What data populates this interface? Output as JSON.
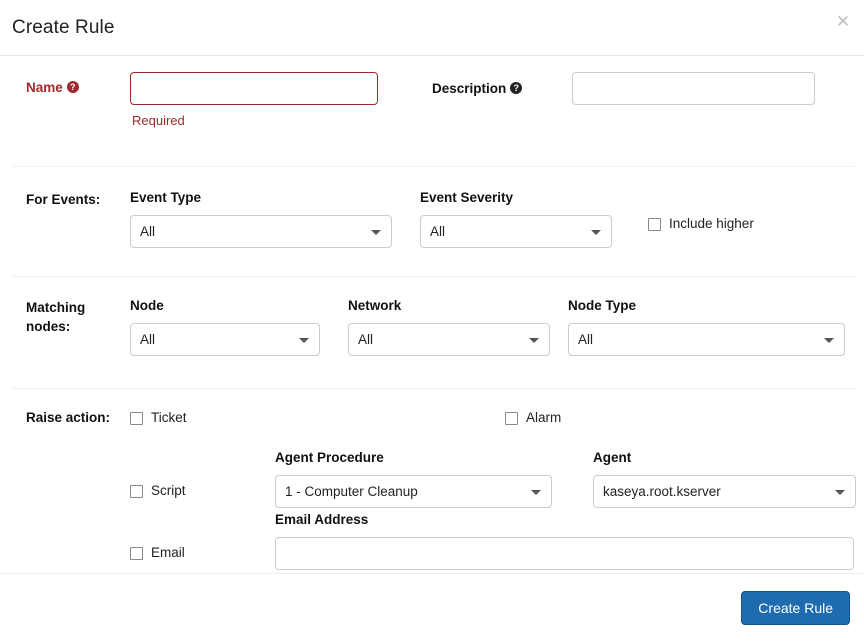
{
  "dialog": {
    "title": "Create Rule",
    "close_icon": "close-icon",
    "close_label": "✕"
  },
  "name_section": {
    "label": "Name",
    "help_icon": "help-icon",
    "input_value": "",
    "placeholder": "",
    "validation_message": "Required",
    "description_label": "Description",
    "description_help_icon": "help-icon",
    "description_value": "",
    "description_placeholder": ""
  },
  "events_section": {
    "gutter_label": "For Events:",
    "event_type_label": "Event Type",
    "event_type_value": "All",
    "event_severity_label": "Event Severity",
    "event_severity_value": "All",
    "include_higher_label": "Include higher",
    "include_higher_checked": false
  },
  "matching_section": {
    "gutter_label": "Matching nodes:",
    "node_label": "Node",
    "node_value": "All",
    "network_label": "Network",
    "network_value": "All",
    "node_type_label": "Node Type",
    "node_type_value": "All"
  },
  "raise_section": {
    "gutter_label": "Raise action:",
    "ticket_label": "Ticket",
    "ticket_checked": false,
    "alarm_label": "Alarm",
    "alarm_checked": false,
    "script_label": "Script",
    "script_checked": false,
    "agent_procedure_label": "Agent Procedure",
    "agent_procedure_value": "1 - Computer Cleanup",
    "agent_label": "Agent",
    "agent_value": "kaseya.root.kserver",
    "email_label": "Email",
    "email_checked": false,
    "email_address_label": "Email Address",
    "email_address_value": "",
    "email_address_placeholder": ""
  },
  "footer": {
    "create_button_label": "Create Rule"
  },
  "colors": {
    "required_red": "#9e2a2b",
    "primary_blue": "#1f6bb0",
    "divider": "#f0f0f0",
    "border": "#cccccc"
  }
}
